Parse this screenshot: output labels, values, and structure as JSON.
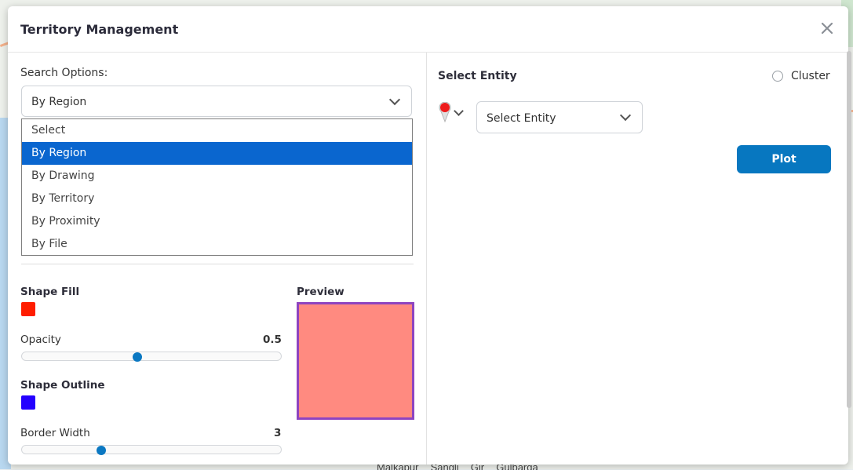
{
  "modal": {
    "title": "Territory Management"
  },
  "search": {
    "label": "Search Options:",
    "selected": "By Region",
    "options": [
      "Select",
      "By Region",
      "By Drawing",
      "By Territory",
      "By Proximity",
      "By File"
    ]
  },
  "style": {
    "shape_fill_label": "Shape Fill",
    "shape_fill_color": "#ff1d00",
    "opacity_label": "Opacity",
    "opacity_value": "0.5",
    "shape_outline_label": "Shape Outline",
    "shape_outline_color": "#2400ff",
    "border_width_label": "Border Width",
    "border_width_value": "3",
    "preview_label": "Preview",
    "preview_fill": "#ff8a80",
    "preview_outline": "#8e44c0"
  },
  "entity": {
    "label": "Select Entity",
    "cluster_label": "Cluster",
    "select_placeholder": "Select Entity",
    "plot_label": "Plot"
  },
  "map": {
    "bottom_labels": [
      "Malkapur",
      "Sangli",
      "Gir",
      "Gulbarga"
    ]
  },
  "colors": {
    "accent": "#0777c0",
    "dropdown_highlight": "#0a66cf"
  }
}
